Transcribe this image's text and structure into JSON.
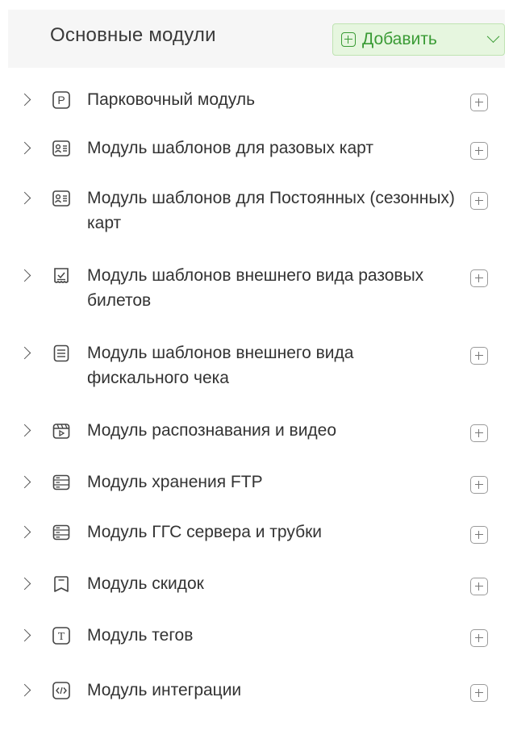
{
  "header": {
    "title": "Основные модули",
    "add_button_label": "Добавить"
  },
  "modules": [
    {
      "label": "Парковочный модуль",
      "icon": "parking-icon"
    },
    {
      "label": "Модуль шаблонов для разовых карт",
      "icon": "card-icon"
    },
    {
      "label": "Модуль шаблонов для Постоянных (сезонных) карт",
      "icon": "card-icon"
    },
    {
      "label": "Модуль шаблонов внешнего вида разовых билетов",
      "icon": "ticket-icon"
    },
    {
      "label": "Модуль шаблонов внешнего вида фискального чека",
      "icon": "receipt-icon"
    },
    {
      "label": "Модуль распознавания и видео",
      "icon": "video-icon"
    },
    {
      "label": "Модуль хранения FTP",
      "icon": "storage-icon"
    },
    {
      "label": "Модуль ГГС сервера и трубки",
      "icon": "server-icon"
    },
    {
      "label": "Модуль скидок",
      "icon": "discount-icon"
    },
    {
      "label": "Модуль тегов",
      "icon": "tag-icon"
    },
    {
      "label": "Модуль интеграции",
      "icon": "integration-icon"
    }
  ],
  "colors": {
    "accent": "#3a9b35",
    "add_bg": "#e6f6df",
    "header_bg": "#f6f6f6"
  }
}
